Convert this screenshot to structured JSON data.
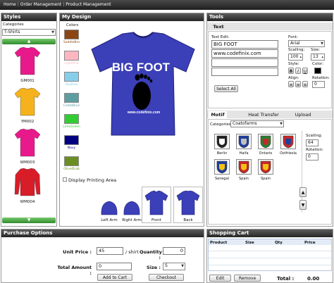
{
  "nav": {
    "items": [
      "Home",
      "Order Management",
      "Product Management"
    ]
  },
  "styles": {
    "title": "Styles",
    "category_label": "Categories",
    "category_value": "T-Shirts",
    "products": [
      {
        "code": "GM001",
        "color": "#e8198b",
        "kind": "tee"
      },
      {
        "code": "YM002",
        "color": "#f5b21c",
        "kind": "tee"
      },
      {
        "code": "WM003",
        "color": "#e8198b",
        "kind": "tee"
      },
      {
        "code": "WM004",
        "color": "#d81c28",
        "kind": "long"
      }
    ]
  },
  "design": {
    "title": "My Design",
    "colors_label": "Colors",
    "colors": [
      {
        "name": "SaddleBro",
        "hex": "#8b4513"
      },
      {
        "name": "LightPink",
        "hex": "#ffb6c1"
      },
      {
        "name": "SkyBlue",
        "hex": "#87ceeb"
      },
      {
        "name": "CadetBlue",
        "hex": "#5f9ea0"
      },
      {
        "name": "LimeGreen",
        "hex": "#32cd32"
      },
      {
        "name": "Navy",
        "hex": "#000080"
      },
      {
        "name": "OliveDrab",
        "hex": "#6b8e23"
      }
    ],
    "shirt_color": "#3b3fb8",
    "shirt_text_main": "BIG FOOT",
    "shirt_text_url": "www.codefinix.com",
    "display_printing_area": "Display Printing Area",
    "views": [
      "Left Arm",
      "Right Arm",
      "Front",
      "Back"
    ]
  },
  "tools": {
    "title": "Tools",
    "tab_text": "Text",
    "text_edit_label": "Text Edit:",
    "lines": [
      "BIG FOOT",
      "www.codefinix.com",
      "",
      ""
    ],
    "font_label": "Font:",
    "font_value": "Arial",
    "scaling_label": "Scalling:",
    "scaling_value": "100",
    "size_label": "Size:",
    "size_value": "13",
    "style_label": "Style:",
    "style_buttons": [
      "B",
      "I",
      "U"
    ],
    "color_label": "Color:",
    "align_label": "Align:",
    "rotation_label": "Rotation:",
    "rotation_value": "0",
    "select_all": "Select All",
    "tabs2": [
      "Motif",
      "Heat Transfer",
      "Upload Image"
    ],
    "categories_label": "Categories:",
    "categories_value": "Coatofarms",
    "motifs": [
      {
        "name": "Berlin",
        "c1": "#222222",
        "c2": "#ffffff"
      },
      {
        "name": "Haifa",
        "c1": "#1f3f9f",
        "c2": "#c0c0c0"
      },
      {
        "name": "Ontario",
        "c1": "#2e7d32",
        "c2": "#c62828"
      },
      {
        "name": "Ostfriesla",
        "c1": "#c62828",
        "c2": "#1f3f9f"
      },
      {
        "name": "Senegal",
        "c1": "#1f3f9f",
        "c2": "#f4c20d"
      },
      {
        "name": "Spain",
        "c1": "#c62828",
        "c2": "#f4c20d"
      },
      {
        "name": "Spain",
        "c1": "#c62828",
        "c2": "#f4c20d"
      }
    ],
    "motif_scaling_label": "Scalling:",
    "motif_scaling_value": "64",
    "motif_rotation_label": "Rotation:",
    "motif_rotation_value": "0"
  },
  "purchase": {
    "title": "Purchase Options",
    "unit_price_label": "Unit Price :",
    "unit_price_value": "45",
    "per_shirt": "/ shirt",
    "quantity_label": "Quantity :",
    "quantity_value": "0",
    "total_label": "Total Amount :",
    "total_value": "0",
    "size_label": "Size :",
    "size_value": "S",
    "add_to_cart": "Add to Cart",
    "checkout": "Checkout"
  },
  "cart": {
    "title": "Shopping Cart",
    "columns": [
      "Product",
      "Size",
      "Qty",
      "Price"
    ],
    "edit": "Edit",
    "remove": "Remove",
    "total_label": "Total :",
    "total_value": "0.00"
  }
}
